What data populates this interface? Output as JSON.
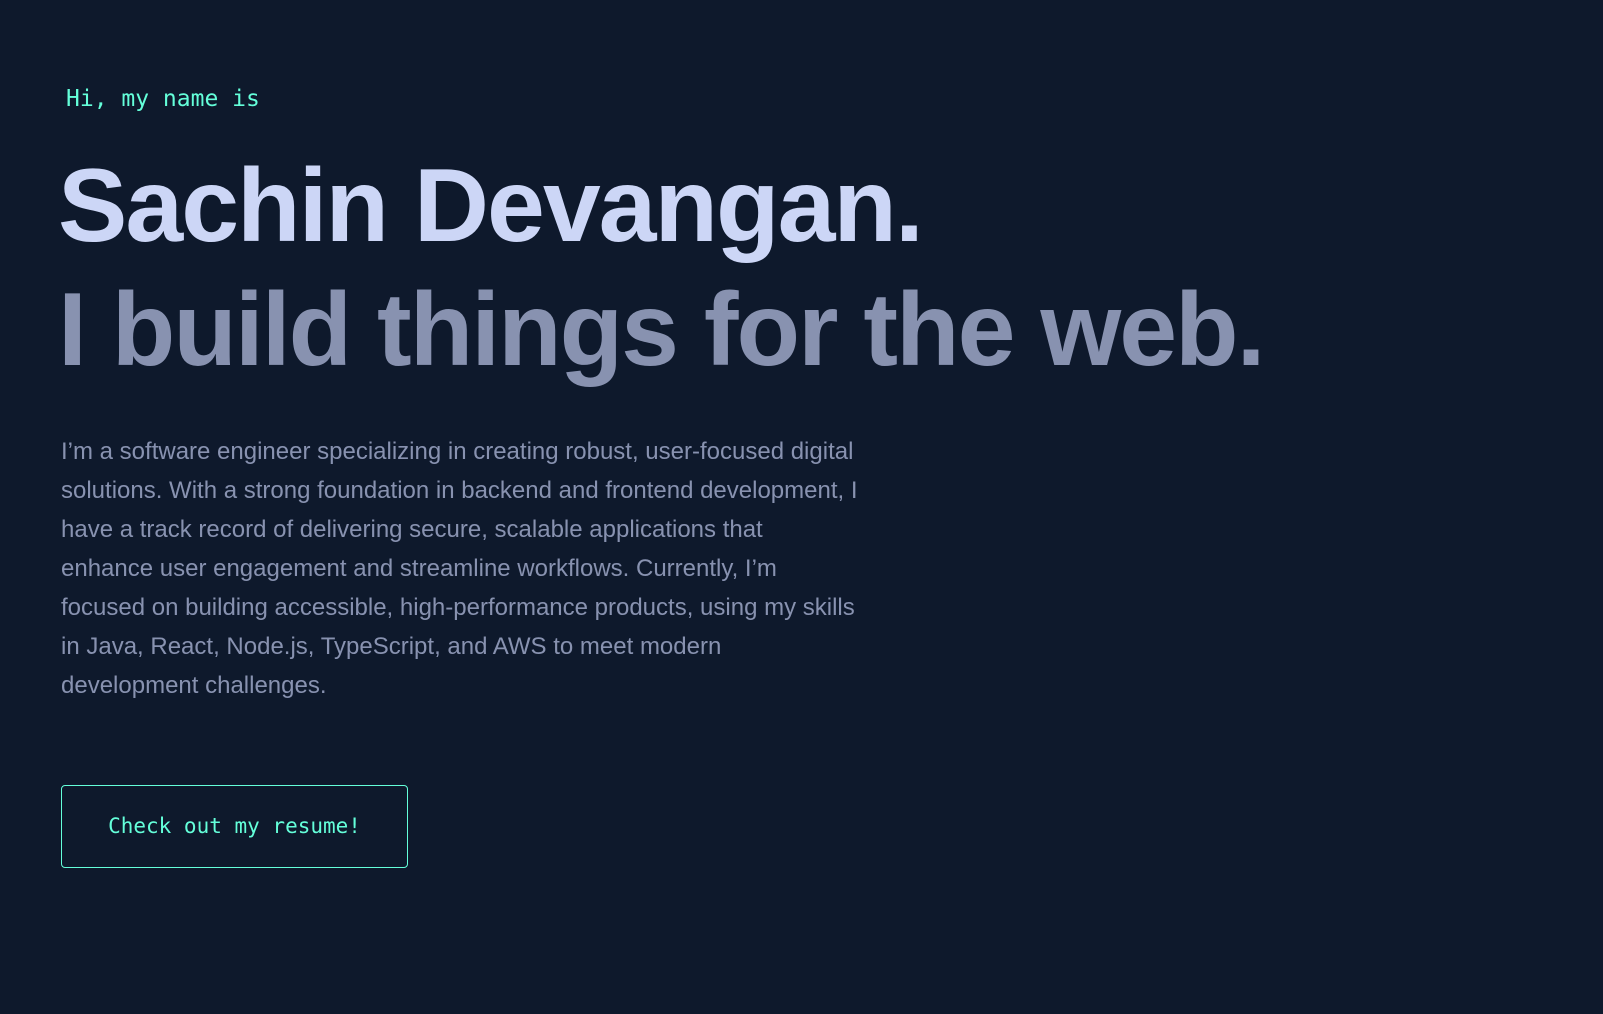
{
  "hero": {
    "greeting": "Hi, my name is",
    "name": "Sachin Devangan.",
    "tagline": "I build things for the web.",
    "bio": "I’m a software engineer specializing in creating robust, user-focused digital solutions. With a strong foundation in backend and frontend development, I have a track record of delivering secure, scalable applications that enhance user engagement and streamline workflows. Currently, I’m focused on building accessible, high-performance products, using my skills in Java, React, Node.js, TypeScript, and AWS to meet modern development challenges.",
    "resume_button_label": "Check out my resume!"
  },
  "colors": {
    "background": "#0e192c",
    "accent": "#64ffda",
    "heading": "#ccd6f6",
    "muted": "#8892b0"
  }
}
